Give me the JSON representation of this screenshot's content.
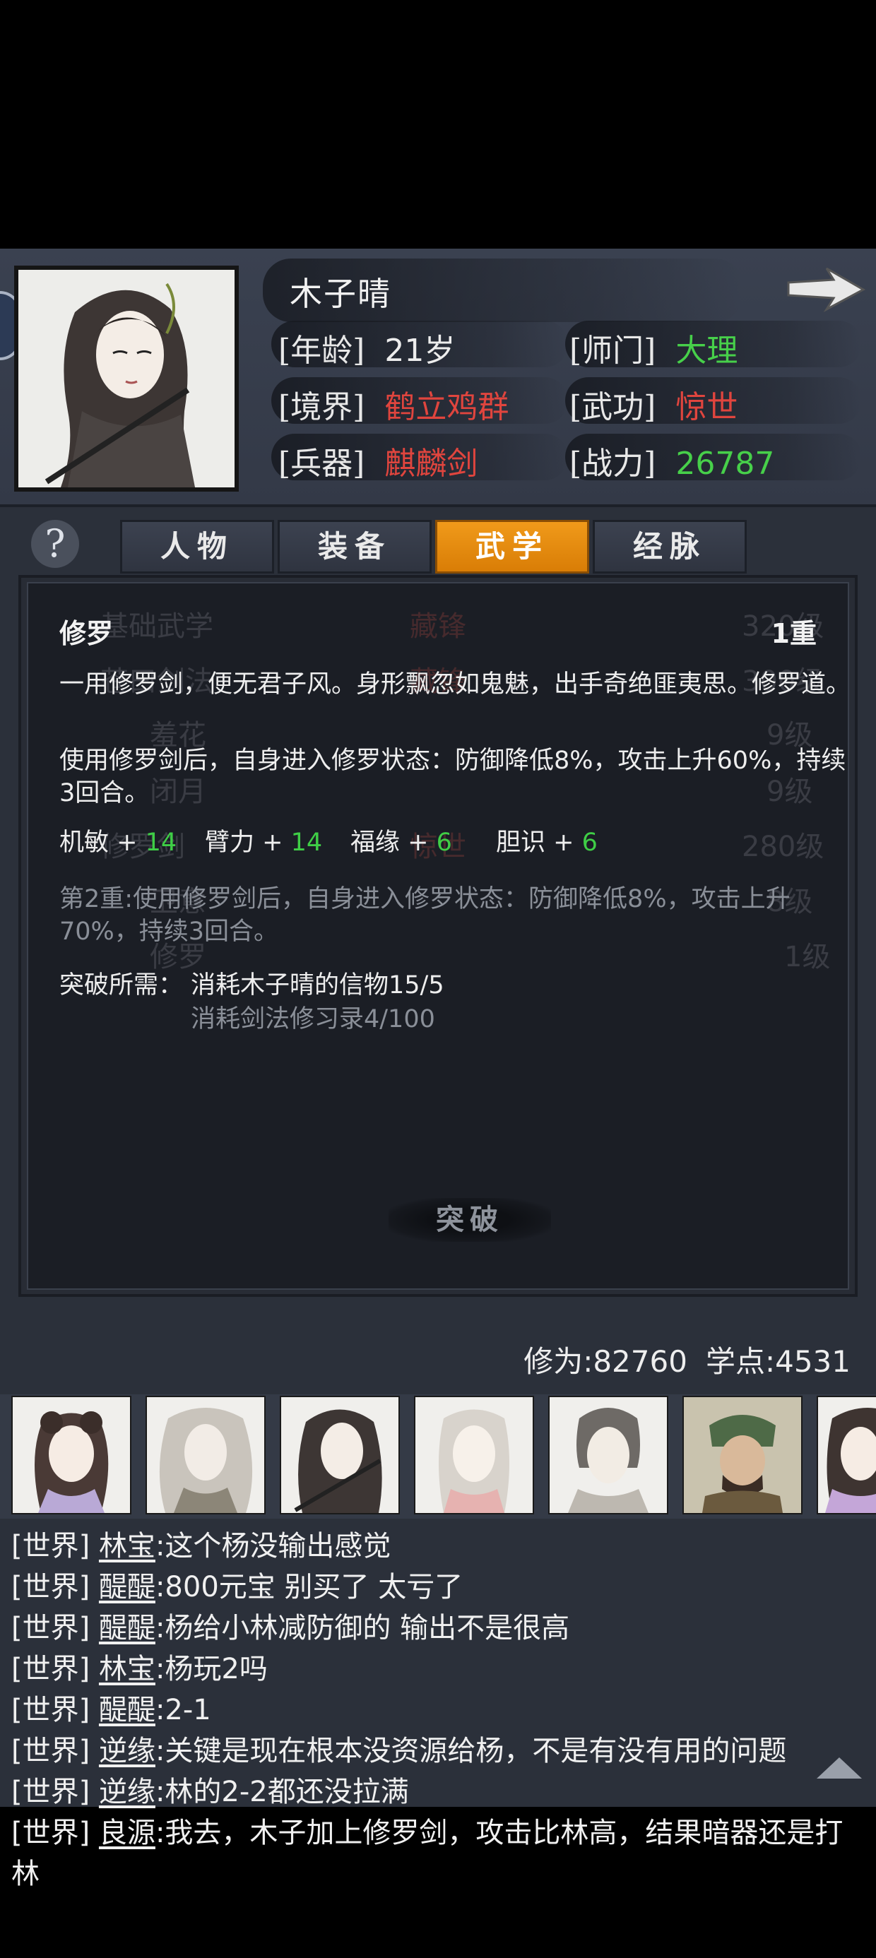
{
  "character": {
    "name": "木子晴",
    "stats": [
      {
        "label": "[年龄]",
        "value": "21岁",
        "color": "#ededed"
      },
      {
        "label": "[师门]",
        "value": "大理",
        "color": "#47d04a"
      },
      {
        "label": "[境界]",
        "value": "鹤立鸡群",
        "color": "#e0453e"
      },
      {
        "label": "[武功]",
        "value": "惊世",
        "color": "#e0453e"
      },
      {
        "label": "[兵器]",
        "value": "麒麟剑",
        "color": "#e0453e"
      },
      {
        "label": "[战力]",
        "value": "26787",
        "color": "#47d04a"
      }
    ]
  },
  "help_label": "?",
  "tabs": [
    {
      "label": "人物",
      "active": false
    },
    {
      "label": "装备",
      "active": false
    },
    {
      "label": "武学",
      "active": true
    },
    {
      "label": "经脉",
      "active": false
    }
  ],
  "background_list": [
    {
      "name": "基础武学",
      "rank": "藏锋",
      "level": "320级"
    },
    {
      "name": "苍曰剑法",
      "rank": "藏锋",
      "level": "300级"
    },
    {
      "name": "羞花",
      "rank": "",
      "level": "9级"
    },
    {
      "name": "闭月",
      "rank": "",
      "level": "9级"
    },
    {
      "name": "修罗剑",
      "rank": "惊世",
      "level": "280级"
    },
    {
      "name": "卫意",
      "rank": "",
      "level": "8级"
    },
    {
      "name": "修罗",
      "rank": "",
      "level": "1级"
    }
  ],
  "skill": {
    "name": "修罗",
    "level": "1重",
    "description": "一用修罗剑，便无君子风。身形飘忽如鬼魅，出手奇绝匪夷思。修罗道。",
    "effect": "使用修罗剑后，自身进入修罗状态：防御降低8%，攻击上升60%，持续3回合。",
    "attributes": [
      {
        "name": "机敏 +",
        "value": "14"
      },
      {
        "name": "臂力 +",
        "value": "14"
      },
      {
        "name": "福缘 +",
        "value": "6"
      },
      {
        "name": "胆识 +",
        "value": "6"
      }
    ],
    "next_level": "第2重:使用修罗剑后，自身进入修罗状态：防御降低8%，攻击上升70%，持续3回合。",
    "requirement_label": "突破所需：",
    "requirements": [
      "消耗木子晴的信物15/5",
      "消耗剑法修习录4/100"
    ],
    "break_button": "突破"
  },
  "points": {
    "cultivation": "修为:82760",
    "study": "学点:4531"
  },
  "chat": [
    {
      "channel": "[世界]",
      "user": "林宝",
      "text": ":这个杨没输出感觉"
    },
    {
      "channel": "[世界]",
      "user": "醍醍",
      "text": ":800元宝 别买了 太亏了"
    },
    {
      "channel": "[世界]",
      "user": "醍醍",
      "text": ":杨给小林减防御的 输出不是很高"
    },
    {
      "channel": "[世界]",
      "user": "林宝",
      "text": ":杨玩2吗"
    },
    {
      "channel": "[世界]",
      "user": "醍醍",
      "text": ":2-1"
    },
    {
      "channel": "[世界]",
      "user": "逆缘",
      "text": ":关键是现在根本没资源给杨，不是有没有用的问题"
    },
    {
      "channel": "[世界]",
      "user": "逆缘",
      "text": ":林的2-2都还没拉满"
    },
    {
      "channel": "[世界]",
      "user": "良源",
      "text": ":我去，木子加上修罗剑，攻击比林高，结果暗器还是打林"
    }
  ],
  "icons": {
    "next": "arrow-right-icon",
    "scroll": "triangle-up-icon"
  }
}
